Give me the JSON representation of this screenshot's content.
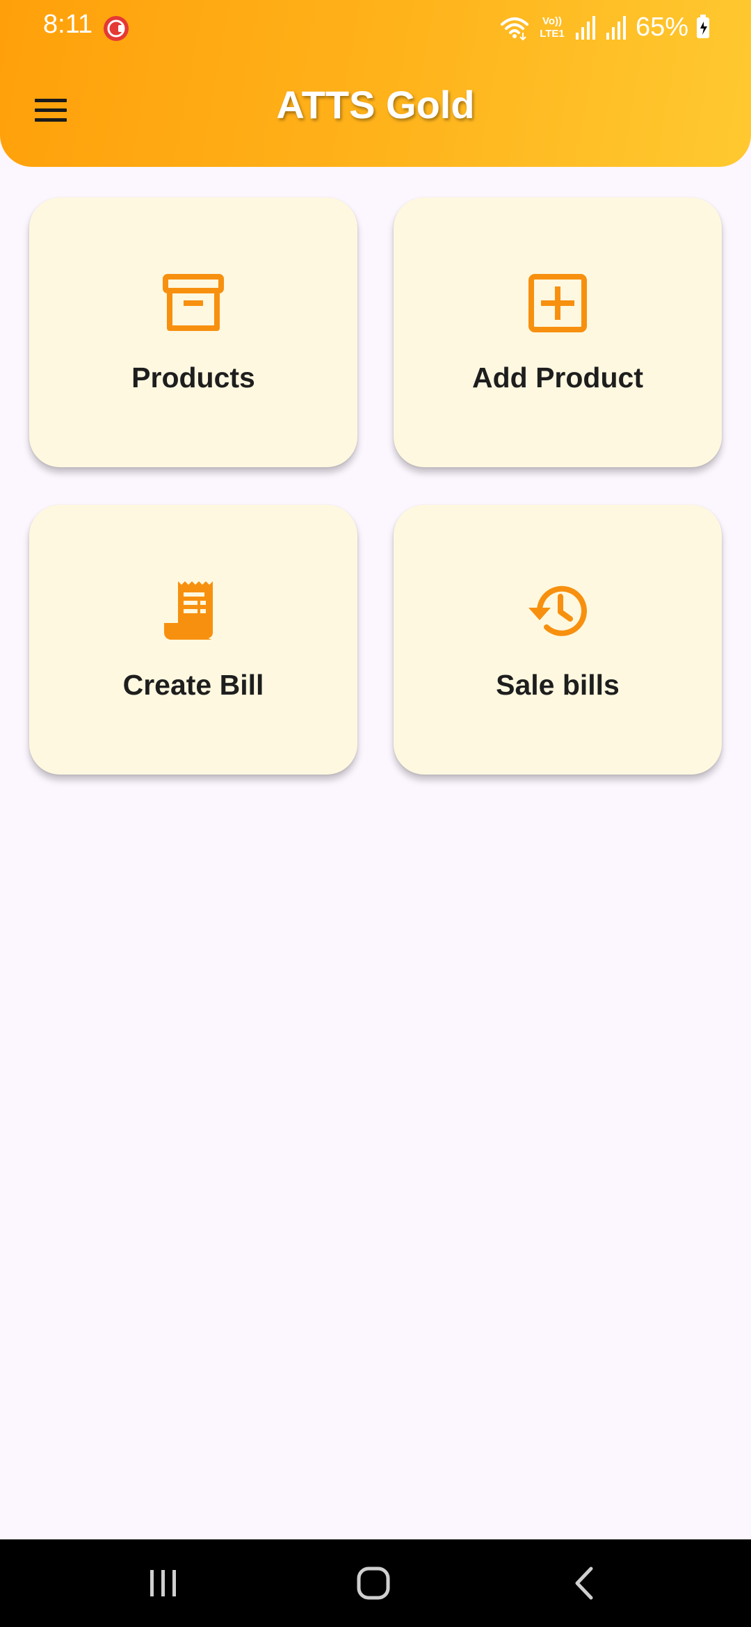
{
  "status_bar": {
    "time": "8:11",
    "network_label": "Vo)) LTE1",
    "battery": "65%"
  },
  "app_bar": {
    "title": "ATTS Gold",
    "gradient_start": "#ffa00a",
    "gradient_end": "#ffc930"
  },
  "tiles": [
    {
      "label": "Products",
      "icon": "archive-box-icon"
    },
    {
      "label": "Add Product",
      "icon": "add-box-icon"
    },
    {
      "label": "Create Bill",
      "icon": "receipt-icon"
    },
    {
      "label": "Sale bills",
      "icon": "history-icon"
    }
  ],
  "colors": {
    "accent": "#f7900f",
    "tile_background": "#fef8e0",
    "page_background": "#fcf6fe"
  },
  "nav_bar": {
    "items": [
      "recents-icon",
      "home-icon",
      "back-icon"
    ]
  }
}
